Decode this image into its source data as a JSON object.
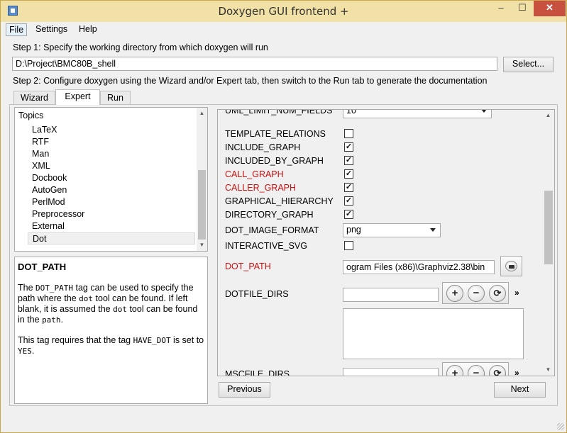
{
  "window": {
    "title": "Doxygen GUI frontend +",
    "minimize": "–",
    "maximize": "☐",
    "close": "✕"
  },
  "menu": [
    "File",
    "Settings",
    "Help"
  ],
  "step1": {
    "label": "Step 1: Specify the working directory from which doxygen will run",
    "path": "D:\\Project\\BMC80B_shell",
    "select_button": "Select..."
  },
  "step2": {
    "label": "Step 2: Configure doxygen using the Wizard and/or Expert tab, then switch to the Run tab to generate the documentation"
  },
  "tabs": [
    "Wizard",
    "Expert",
    "Run"
  ],
  "active_tab": "Expert",
  "topics": {
    "header": "Topics",
    "items": [
      "LaTeX",
      "RTF",
      "Man",
      "XML",
      "Docbook",
      "AutoGen",
      "PerlMod",
      "Preprocessor",
      "External",
      "Dot"
    ],
    "selected": "Dot"
  },
  "help": {
    "title": "DOT_PATH",
    "p1_a": "The ",
    "p1_code1": "DOT_PATH",
    "p1_b": " tag can be used to specify the path where the ",
    "p1_code2": "dot",
    "p1_c": " tool can be found. If left blank, it is assumed the ",
    "p1_code3": "dot",
    "p1_d": " tool can be found in the ",
    "p1_code4": "path",
    "p1_e": ".",
    "p2_a": "This tag requires that the tag ",
    "p2_code1": "HAVE_DOT",
    "p2_b": " is set to ",
    "p2_code2": "YES",
    "p2_c": "."
  },
  "settings": {
    "uml_limit": {
      "name": "UML_LIMIT_NUM_FIELDS",
      "value": "10"
    },
    "template_relations": {
      "name": "TEMPLATE_RELATIONS",
      "checked": false
    },
    "include_graph": {
      "name": "INCLUDE_GRAPH",
      "checked": true
    },
    "included_by_graph": {
      "name": "INCLUDED_BY_GRAPH",
      "checked": true
    },
    "call_graph": {
      "name": "CALL_GRAPH",
      "checked": true
    },
    "caller_graph": {
      "name": "CALLER_GRAPH",
      "checked": true
    },
    "graphical_hierarchy": {
      "name": "GRAPHICAL_HIERARCHY",
      "checked": true
    },
    "directory_graph": {
      "name": "DIRECTORY_GRAPH",
      "checked": true
    },
    "dot_image_format": {
      "name": "DOT_IMAGE_FORMAT",
      "value": "png"
    },
    "interactive_svg": {
      "name": "INTERACTIVE_SVG",
      "checked": false
    },
    "dot_path": {
      "name": "DOT_PATH",
      "value": "ogram Files (x86)\\Graphviz2.38\\bin"
    },
    "dotfile_dirs": {
      "name": "DOTFILE_DIRS",
      "value": "",
      "more": "»"
    },
    "mscfile_dirs": {
      "name": "MSCFILE_DIRS",
      "value": "",
      "more": "»"
    }
  },
  "nav": {
    "previous": "Previous",
    "next": "Next"
  },
  "colors": {
    "titlebar": "#f2e1a6",
    "close_button": "#c7503f",
    "changed_setting": "#cc1010"
  }
}
